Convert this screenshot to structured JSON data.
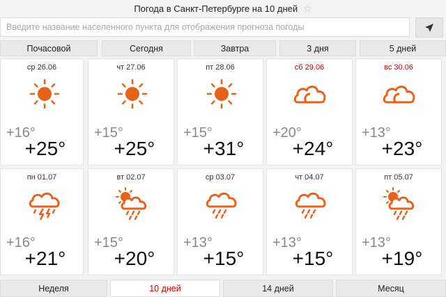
{
  "header": {
    "title": "Погода в Санкт-Петербурге на 10 дней",
    "star_icon": "star-icon"
  },
  "search": {
    "placeholder": "Введите название населенного пункта для отображения прогноза погоды",
    "locate_icon": "location-arrow-icon"
  },
  "tabs": [
    {
      "label": "Почасовой",
      "active": false
    },
    {
      "label": "Сегодня",
      "active": false
    },
    {
      "label": "Завтра",
      "active": false
    },
    {
      "label": "3 дня",
      "active": false
    },
    {
      "label": "5 дней",
      "active": false
    }
  ],
  "days": [
    {
      "date": "ср 26.06",
      "weekend": false,
      "icon": "sun-icon",
      "min": "+16°",
      "max": "+25°"
    },
    {
      "date": "чт 27.06",
      "weekend": false,
      "icon": "sun-icon",
      "min": "+15°",
      "max": "+25°"
    },
    {
      "date": "пт 28.06",
      "weekend": false,
      "icon": "sun-icon",
      "min": "+15°",
      "max": "+31°"
    },
    {
      "date": "сб 29.06",
      "weekend": true,
      "icon": "cloud-icon",
      "min": "+20°",
      "max": "+24°"
    },
    {
      "date": "вс 30.06",
      "weekend": true,
      "icon": "cloud-icon",
      "min": "+13°",
      "max": "+23°"
    },
    {
      "date": "пн 01.07",
      "weekend": false,
      "icon": "thunderstorm-rain-icon",
      "min": "+16°",
      "max": "+21°"
    },
    {
      "date": "вт 02.07",
      "weekend": false,
      "icon": "sun-cloud-rain-icon",
      "min": "+15°",
      "max": "+20°"
    },
    {
      "date": "ср 03.07",
      "weekend": false,
      "icon": "cloud-rain-icon",
      "min": "+13°",
      "max": "+15°"
    },
    {
      "date": "чт 04.07",
      "weekend": false,
      "icon": "cloud-rain-icon",
      "min": "+13°",
      "max": "+15°"
    },
    {
      "date": "пт 05.07",
      "weekend": false,
      "icon": "sun-cloud-rain-icon",
      "min": "+13°",
      "max": "+19°"
    }
  ],
  "bottom_tabs": [
    {
      "label": "Неделя",
      "active": false
    },
    {
      "label": "10 дней",
      "active": true
    },
    {
      "label": "14 дней",
      "active": false
    },
    {
      "label": "Месяц",
      "active": false
    }
  ],
  "colors": {
    "accent": "#cc0000",
    "icon": "#e8611a"
  }
}
